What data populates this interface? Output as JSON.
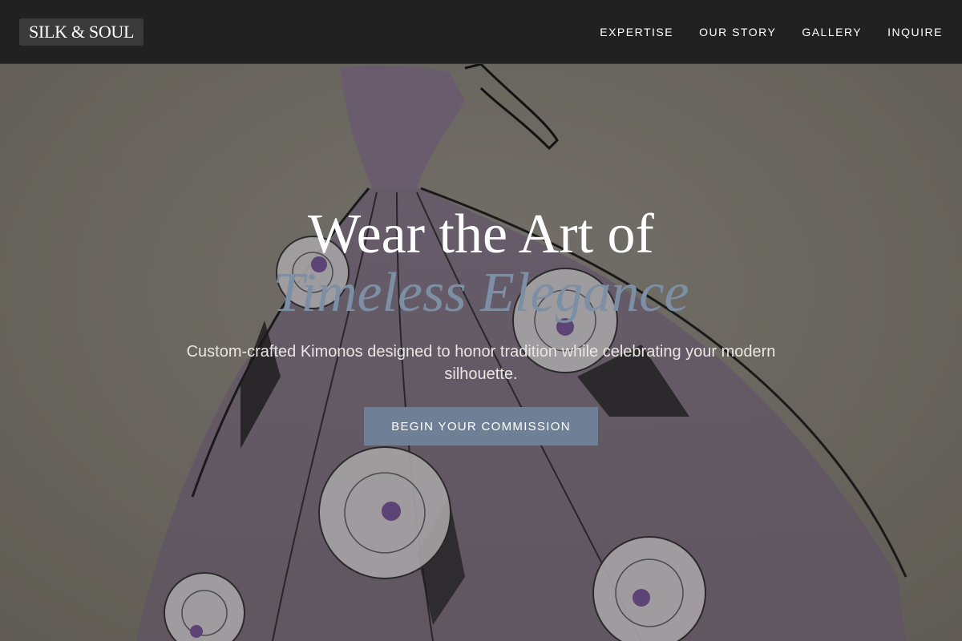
{
  "colors": {
    "accent": "#7d8fa5",
    "button_bg": "#6f8096",
    "nav_bg": "#212121"
  },
  "navbar": {
    "logo": "SILK & SOUL",
    "links": [
      {
        "label": "EXPERTISE"
      },
      {
        "label": "OUR STORY"
      },
      {
        "label": "GALLERY"
      },
      {
        "label": "INQUIRE"
      }
    ]
  },
  "hero": {
    "headline": "Wear the Art of",
    "headline_accent": "Timeless Elegance",
    "subtitle": "Custom-crafted Kimonos designed to honor tradition while celebrating your modern silhouette.",
    "cta_label": "BEGIN YOUR COMMISSION",
    "background_image": "watercolor-gown-sketch"
  }
}
